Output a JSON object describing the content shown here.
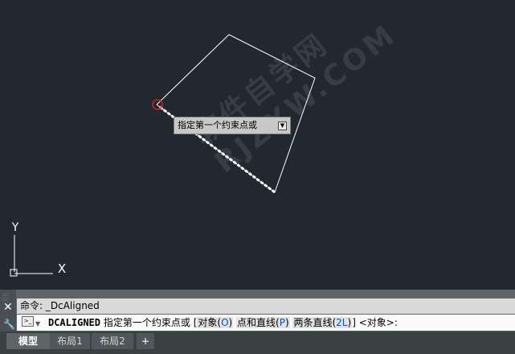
{
  "viewport": {
    "tooltip": {
      "text": "指定第一个约束点或",
      "dropdown_icon": "dropdown-arrow-icon"
    },
    "ucs": {
      "y_label": "Y",
      "x_label": "X"
    },
    "watermark": "软件自学网 RJZXW.COM"
  },
  "command": {
    "history": "命令: _DcAligned",
    "cmd_name": "DCALIGNED",
    "prompt": "指定第一个约束点或",
    "bracket_open": "[",
    "opt1_label": "对象(",
    "opt1_key": "O",
    "opt1_close": ")",
    "opt2_label": "点和直线(",
    "opt2_key": "P",
    "opt2_close": ")",
    "opt3_label": "两条直线(",
    "opt3_key": "2L",
    "opt3_close": ")",
    "bracket_close": "]",
    "default": "<对象>:"
  },
  "tabs": [
    {
      "label": "模型"
    },
    {
      "label": "布局1"
    },
    {
      "label": "布局2"
    },
    {
      "label": "+"
    }
  ],
  "colors": {
    "background": "#212830",
    "accent_key": "#0050d0",
    "marker": "#cc2222"
  }
}
